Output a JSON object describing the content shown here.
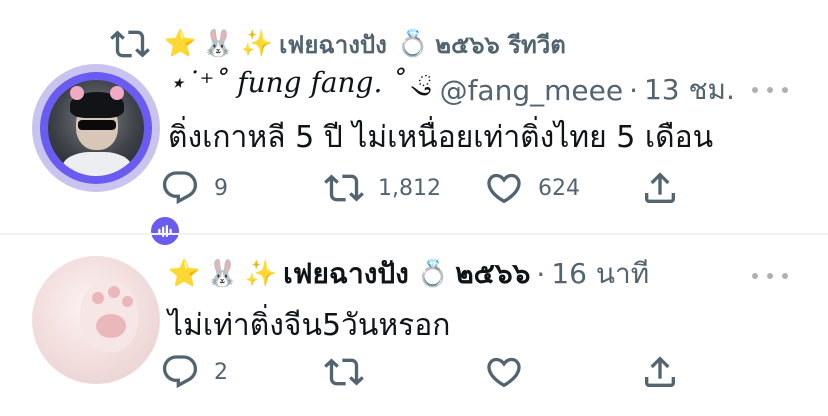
{
  "tweets": [
    {
      "retweet_banner": {
        "icon": "retweet-icon",
        "emojis": [
          "⭐",
          "🐰",
          "✨"
        ],
        "retweeter": "เฟยฉางปัง",
        "ring_emoji": "💍",
        "suffix": "๒๕๖๖ รีทวีต"
      },
      "display_name": "⋆˙⁺˚ fung fang. ˚ ུ",
      "handle": "@fang_meee",
      "separator": "·",
      "time": "13 ชม.",
      "text": "ติ่งเกาหลี 5 ปี ไม่เหนื่อยเท่าติ่งไทย 5 เดือน",
      "counts": {
        "replies": "9",
        "retweets": "1,812",
        "likes": "624"
      }
    },
    {
      "emojis": [
        "⭐",
        "🐰",
        "✨"
      ],
      "display_name": "เฟยฉางปัง",
      "ring_emoji": "💍",
      "name_suffix": "๒๕๖๖",
      "separator": "·",
      "time": "16 นาที",
      "text": "ไม่เท่าติ่งจีน5วันหรอก",
      "counts": {
        "replies": "2",
        "retweets": "",
        "likes": ""
      }
    }
  ],
  "colors": {
    "text": "#0f1419",
    "muted": "#536471",
    "divider": "#eff3f4",
    "avatar_ring": "#6a5cf0"
  }
}
